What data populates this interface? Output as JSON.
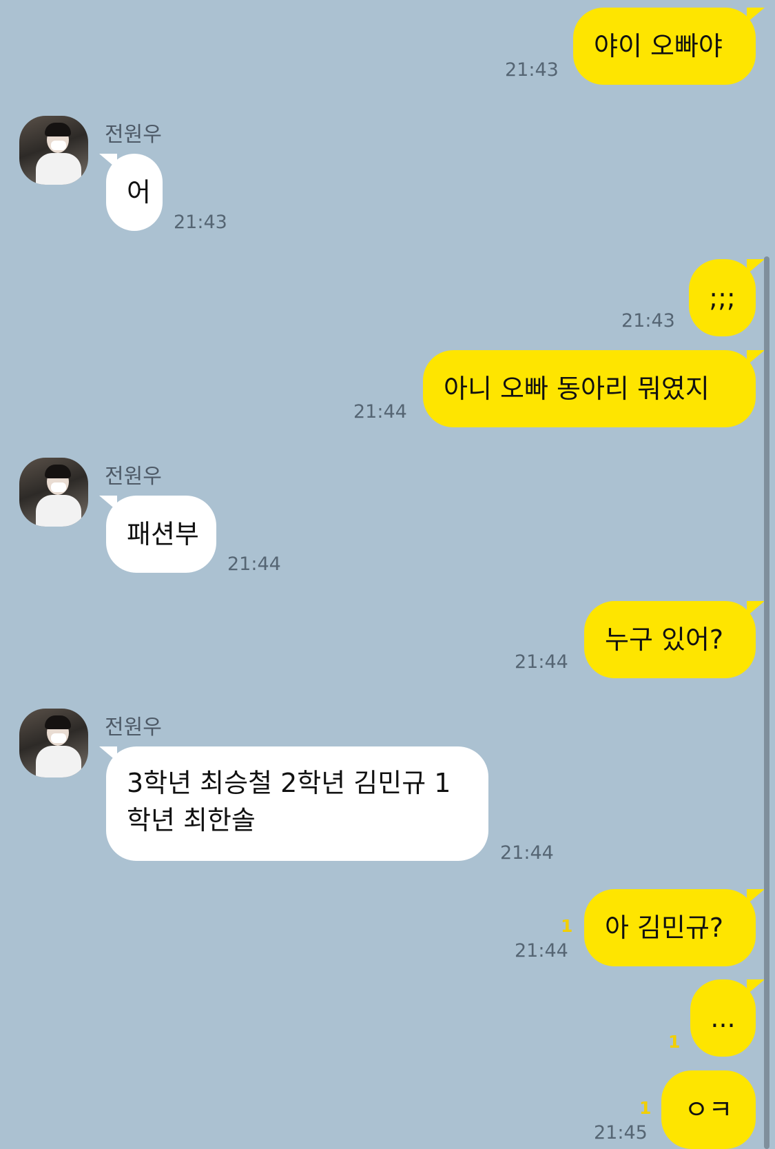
{
  "contact": {
    "name": "전원우"
  },
  "messages": [
    {
      "sender": "me",
      "text": "야이 오빠야",
      "time": "21:43"
    },
    {
      "sender": "them",
      "text": "어",
      "time": "21:43"
    },
    {
      "sender": "me",
      "text": ";;;",
      "time": "21:43"
    },
    {
      "sender": "me",
      "text": "아니 오빠 동아리 뭐였지",
      "time": "21:44"
    },
    {
      "sender": "them",
      "text": "패션부",
      "time": "21:44"
    },
    {
      "sender": "me",
      "text": "누구 있어?",
      "time": "21:44"
    },
    {
      "sender": "them",
      "text": "3학년 최승철 2학년 김민규 1학년 최한솔",
      "time": "21:44"
    },
    {
      "sender": "me",
      "text": "아 김민규?",
      "time": "21:44",
      "unread": "1"
    },
    {
      "sender": "me",
      "text": "...",
      "time": "",
      "unread": "1"
    },
    {
      "sender": "me",
      "text": "ㅇㅋ",
      "time": "21:45",
      "unread": "1"
    }
  ],
  "colors": {
    "background": "#abc1d1",
    "my_bubble": "#fee500",
    "their_bubble": "#ffffff",
    "unread_count": "#f2cf00"
  }
}
